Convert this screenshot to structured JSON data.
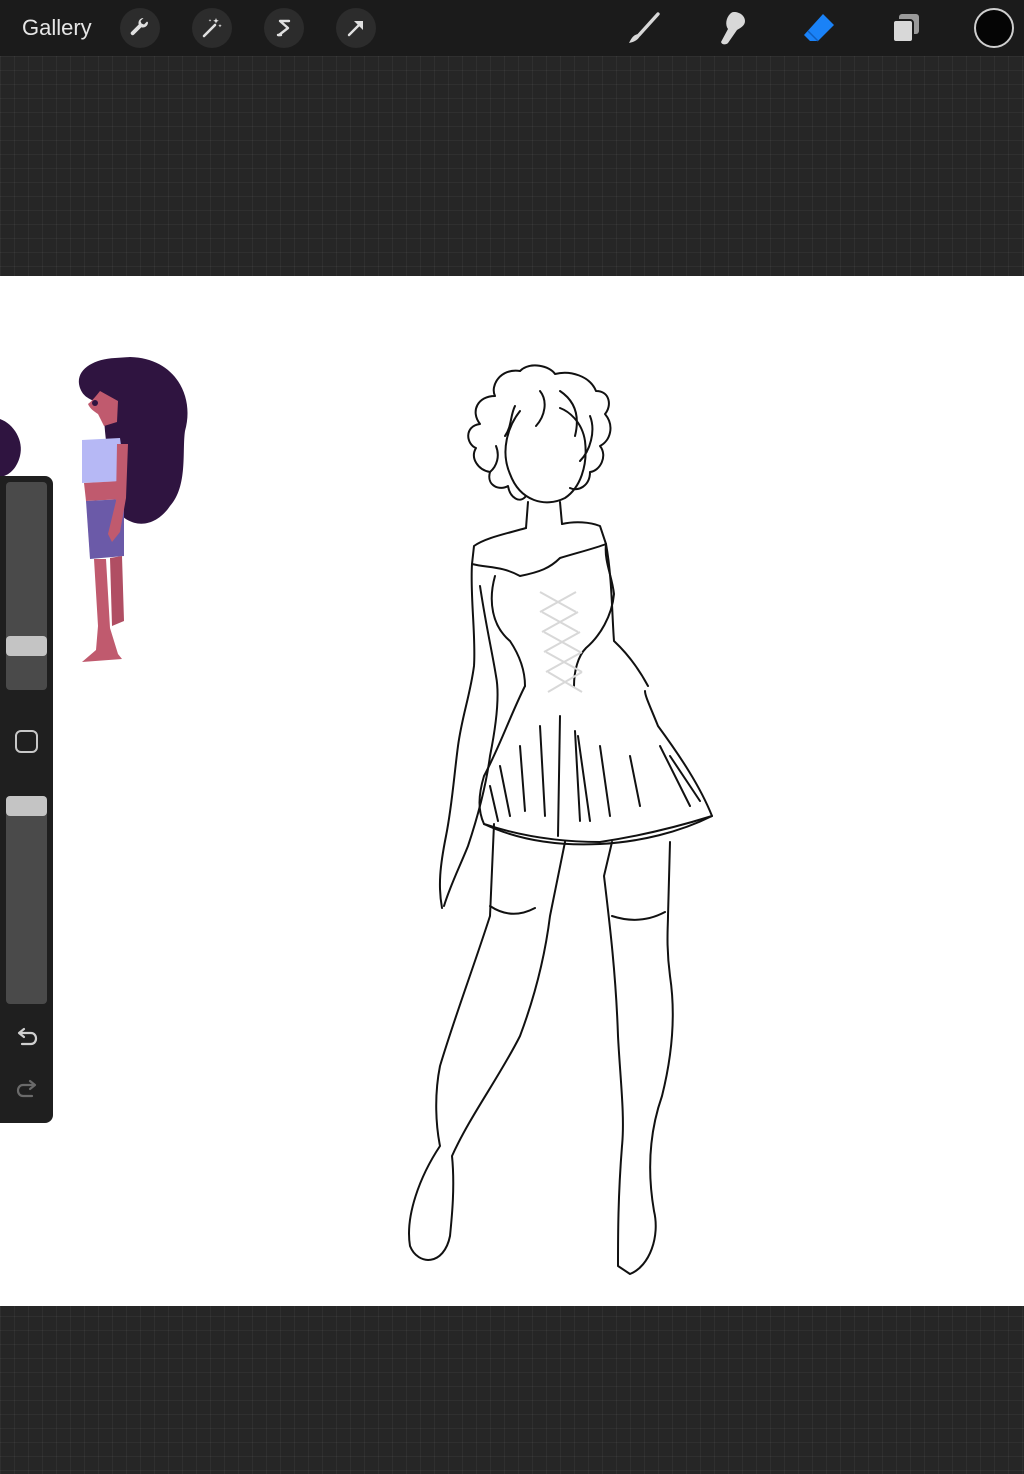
{
  "toolbar": {
    "gallery_label": "Gallery",
    "left_tools": [
      "wrench-icon",
      "magic-wand-icon",
      "selection-icon",
      "transform-arrow-icon"
    ],
    "right_tools": [
      "brush-icon",
      "smudge-icon",
      "eraser-icon",
      "layers-icon"
    ],
    "active_tool": "eraser",
    "accent_color": "#1a82f7",
    "current_color": "#000000"
  },
  "sidebar": {
    "brush_size_level": 0.15,
    "brush_opacity_level": 0.95,
    "tools": [
      "modify-square-icon",
      "undo-icon",
      "redo-icon"
    ]
  },
  "colors": {
    "background": "#262626",
    "toolbar": "#1b1b1b",
    "canvas": "#ffffff",
    "hair": "#2f1440",
    "skin": "#c05a6e",
    "top": "#b6b8f5",
    "shorts": "#6b5aa8"
  }
}
